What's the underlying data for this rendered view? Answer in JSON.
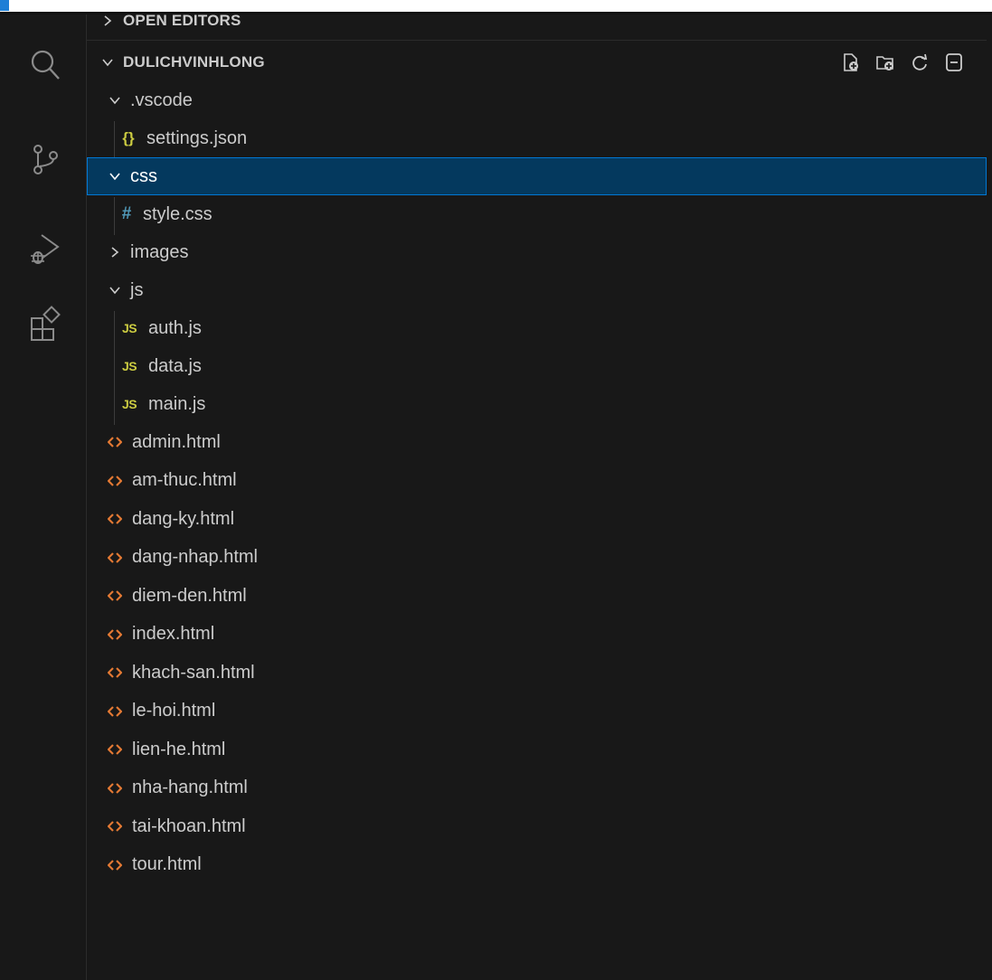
{
  "colors": {
    "background": "#181818",
    "text": "#cccccc",
    "selection_bg": "#04395e",
    "selection_border": "#0078d4",
    "html_icon": "#e37933",
    "js_icon": "#cbcb41",
    "css_icon": "#519aba",
    "json_icon": "#cbcb41"
  },
  "activity_bar": [
    {
      "icon": "search-icon"
    },
    {
      "icon": "source-control-icon"
    },
    {
      "icon": "run-debug-icon"
    },
    {
      "icon": "extensions-icon"
    }
  ],
  "explorer": {
    "open_editors_label": "OPEN EDITORS",
    "project_label": "DULICHVINHLONG",
    "header_actions": [
      "new-file-icon",
      "new-folder-icon",
      "refresh-icon",
      "collapse-all-icon"
    ],
    "tree": {
      "vscode_folder": ".vscode",
      "settings_json": "settings.json",
      "json_glyph": "{}",
      "css_folder": "css",
      "style_css": "style.css",
      "css_glyph": "#",
      "images_folder": "images",
      "js_folder": "js",
      "js_glyph": "JS",
      "js_files": [
        "auth.js",
        "data.js",
        "main.js"
      ],
      "html_files": [
        "admin.html",
        "am-thuc.html",
        "dang-ky.html",
        "dang-nhap.html",
        "diem-den.html",
        "index.html",
        "khach-san.html",
        "le-hoi.html",
        "lien-he.html",
        "nha-hang.html",
        "tai-khoan.html",
        "tour.html"
      ]
    }
  }
}
